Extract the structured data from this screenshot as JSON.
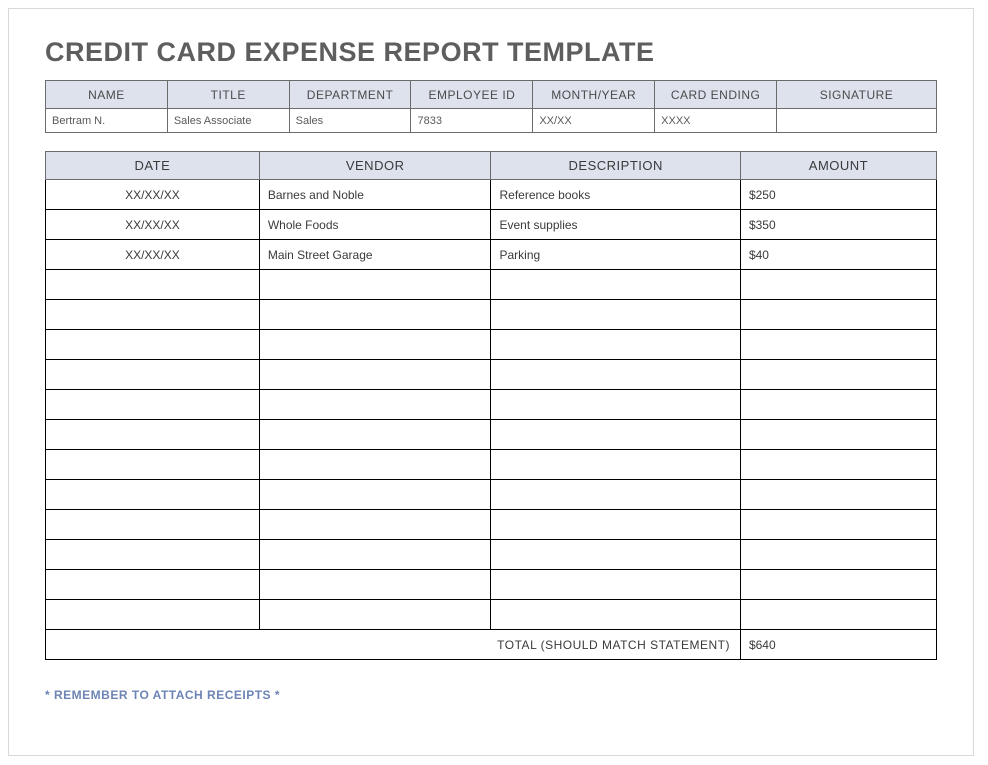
{
  "title": "CREDIT CARD EXPENSE REPORT TEMPLATE",
  "info": {
    "headers": {
      "name": "NAME",
      "title": "TITLE",
      "department": "DEPARTMENT",
      "employee_id": "EMPLOYEE ID",
      "month_year": "MONTH/YEAR",
      "card_ending": "CARD ENDING",
      "signature": "SIGNATURE"
    },
    "values": {
      "name": "Bertram N.",
      "title": "Sales Associate",
      "department": "Sales",
      "employee_id": "7833",
      "month_year": "XX/XX",
      "card_ending": "XXXX",
      "signature": ""
    }
  },
  "expenses": {
    "headers": {
      "date": "DATE",
      "vendor": "VENDOR",
      "description": "DESCRIPTION",
      "amount": "AMOUNT"
    },
    "rows": [
      {
        "date": "XX/XX/XX",
        "vendor": "Barnes and Noble",
        "description": "Reference books",
        "amount": "$250"
      },
      {
        "date": "XX/XX/XX",
        "vendor": "Whole Foods",
        "description": "Event supplies",
        "amount": "$350"
      },
      {
        "date": "XX/XX/XX",
        "vendor": "Main Street Garage",
        "description": "Parking",
        "amount": "$40"
      },
      {
        "date": "",
        "vendor": "",
        "description": "",
        "amount": ""
      },
      {
        "date": "",
        "vendor": "",
        "description": "",
        "amount": ""
      },
      {
        "date": "",
        "vendor": "",
        "description": "",
        "amount": ""
      },
      {
        "date": "",
        "vendor": "",
        "description": "",
        "amount": ""
      },
      {
        "date": "",
        "vendor": "",
        "description": "",
        "amount": ""
      },
      {
        "date": "",
        "vendor": "",
        "description": "",
        "amount": ""
      },
      {
        "date": "",
        "vendor": "",
        "description": "",
        "amount": ""
      },
      {
        "date": "",
        "vendor": "",
        "description": "",
        "amount": ""
      },
      {
        "date": "",
        "vendor": "",
        "description": "",
        "amount": ""
      },
      {
        "date": "",
        "vendor": "",
        "description": "",
        "amount": ""
      },
      {
        "date": "",
        "vendor": "",
        "description": "",
        "amount": ""
      },
      {
        "date": "",
        "vendor": "",
        "description": "",
        "amount": ""
      }
    ],
    "total_label": "TOTAL (SHOULD MATCH STATEMENT)",
    "total_value": "$640"
  },
  "reminder": "* REMEMBER TO ATTACH RECEIPTS *"
}
